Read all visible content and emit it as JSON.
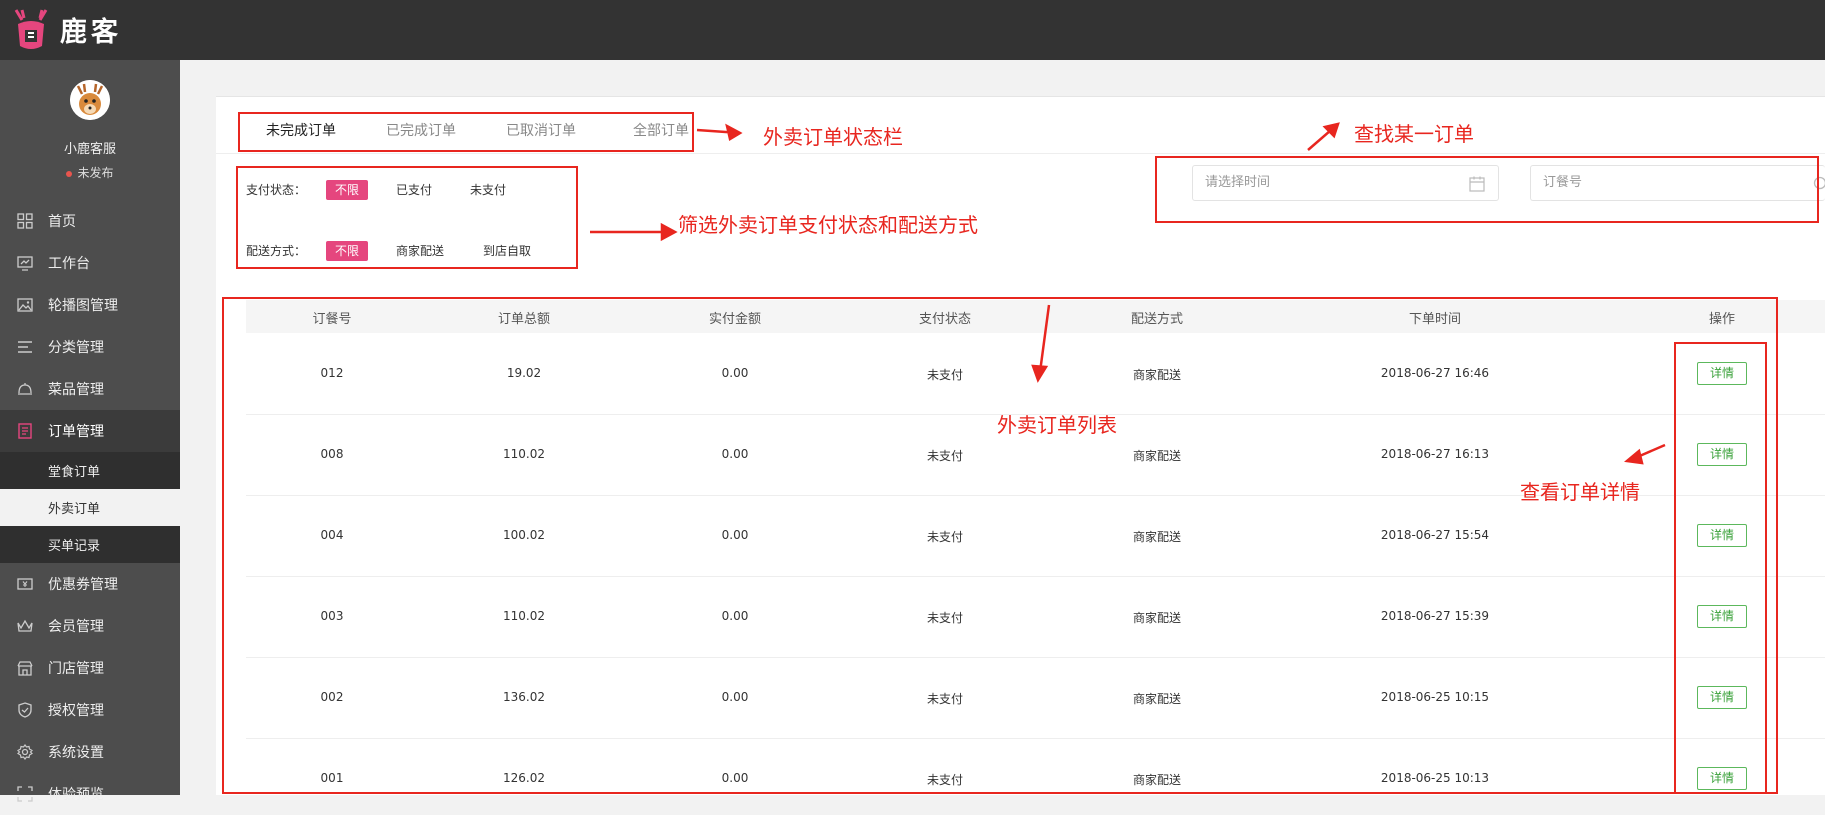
{
  "app": {
    "brand": "鹿客"
  },
  "user": {
    "name": "小鹿客服",
    "status": "未发布"
  },
  "sidebar": {
    "items": [
      {
        "label": "首页",
        "icon": "grid-icon"
      },
      {
        "label": "工作台",
        "icon": "monitor-icon"
      },
      {
        "label": "轮播图管理",
        "icon": "image-icon"
      },
      {
        "label": "分类管理",
        "icon": "list-icon"
      },
      {
        "label": "菜品管理",
        "icon": "cloche-icon"
      },
      {
        "label": "订单管理",
        "icon": "order-icon"
      },
      {
        "label": "优惠券管理",
        "icon": "coupon-icon"
      },
      {
        "label": "会员管理",
        "icon": "crown-icon"
      },
      {
        "label": "门店管理",
        "icon": "store-icon"
      },
      {
        "label": "授权管理",
        "icon": "shield-icon"
      },
      {
        "label": "系统设置",
        "icon": "gear-icon"
      },
      {
        "label": "体验预览",
        "icon": "scan-icon"
      }
    ],
    "subitems": [
      {
        "label": "堂食订单"
      },
      {
        "label": "外卖订单"
      },
      {
        "label": "买单记录"
      }
    ]
  },
  "tabs": [
    {
      "label": "未完成订单"
    },
    {
      "label": "已完成订单"
    },
    {
      "label": "已取消订单"
    },
    {
      "label": "全部订单"
    }
  ],
  "filters": {
    "pay_label": "支付状态：",
    "pay_options": [
      "不限",
      "已支付",
      "未支付"
    ],
    "delivery_label": "配送方式：",
    "delivery_options": [
      "不限",
      "商家配送",
      "到店自取"
    ]
  },
  "search": {
    "date_placeholder": "请选择时间",
    "order_placeholder": "订餐号"
  },
  "table": {
    "columns": [
      "订餐号",
      "订单总额",
      "实付金额",
      "支付状态",
      "配送方式",
      "下单时间",
      "操作"
    ],
    "rows": [
      {
        "id": "012",
        "total": "19.02",
        "paid": "0.00",
        "pay_status": "未支付",
        "delivery": "商家配送",
        "time": "2018-06-27 16:46",
        "action": "详情"
      },
      {
        "id": "008",
        "total": "110.02",
        "paid": "0.00",
        "pay_status": "未支付",
        "delivery": "商家配送",
        "time": "2018-06-27 16:13",
        "action": "详情"
      },
      {
        "id": "004",
        "total": "100.02",
        "paid": "0.00",
        "pay_status": "未支付",
        "delivery": "商家配送",
        "time": "2018-06-27 15:54",
        "action": "详情"
      },
      {
        "id": "003",
        "total": "110.02",
        "paid": "0.00",
        "pay_status": "未支付",
        "delivery": "商家配送",
        "time": "2018-06-27 15:39",
        "action": "详情"
      },
      {
        "id": "002",
        "total": "136.02",
        "paid": "0.00",
        "pay_status": "未支付",
        "delivery": "商家配送",
        "time": "2018-06-25 10:15",
        "action": "详情"
      },
      {
        "id": "001",
        "total": "126.02",
        "paid": "0.00",
        "pay_status": "未支付",
        "delivery": "商家配送",
        "time": "2018-06-25 10:13",
        "action": "详情"
      }
    ]
  },
  "annotations": {
    "status_bar": "外卖订单状态栏",
    "find_order": "查找某一订单",
    "filter": "筛选外卖订单支付状态和配送方式",
    "order_list": "外卖订单列表",
    "view_detail": "查看订单详情"
  },
  "colors": {
    "accent": "#e5467e",
    "annotation": "#e8261f",
    "detail": "#5cb85c"
  }
}
